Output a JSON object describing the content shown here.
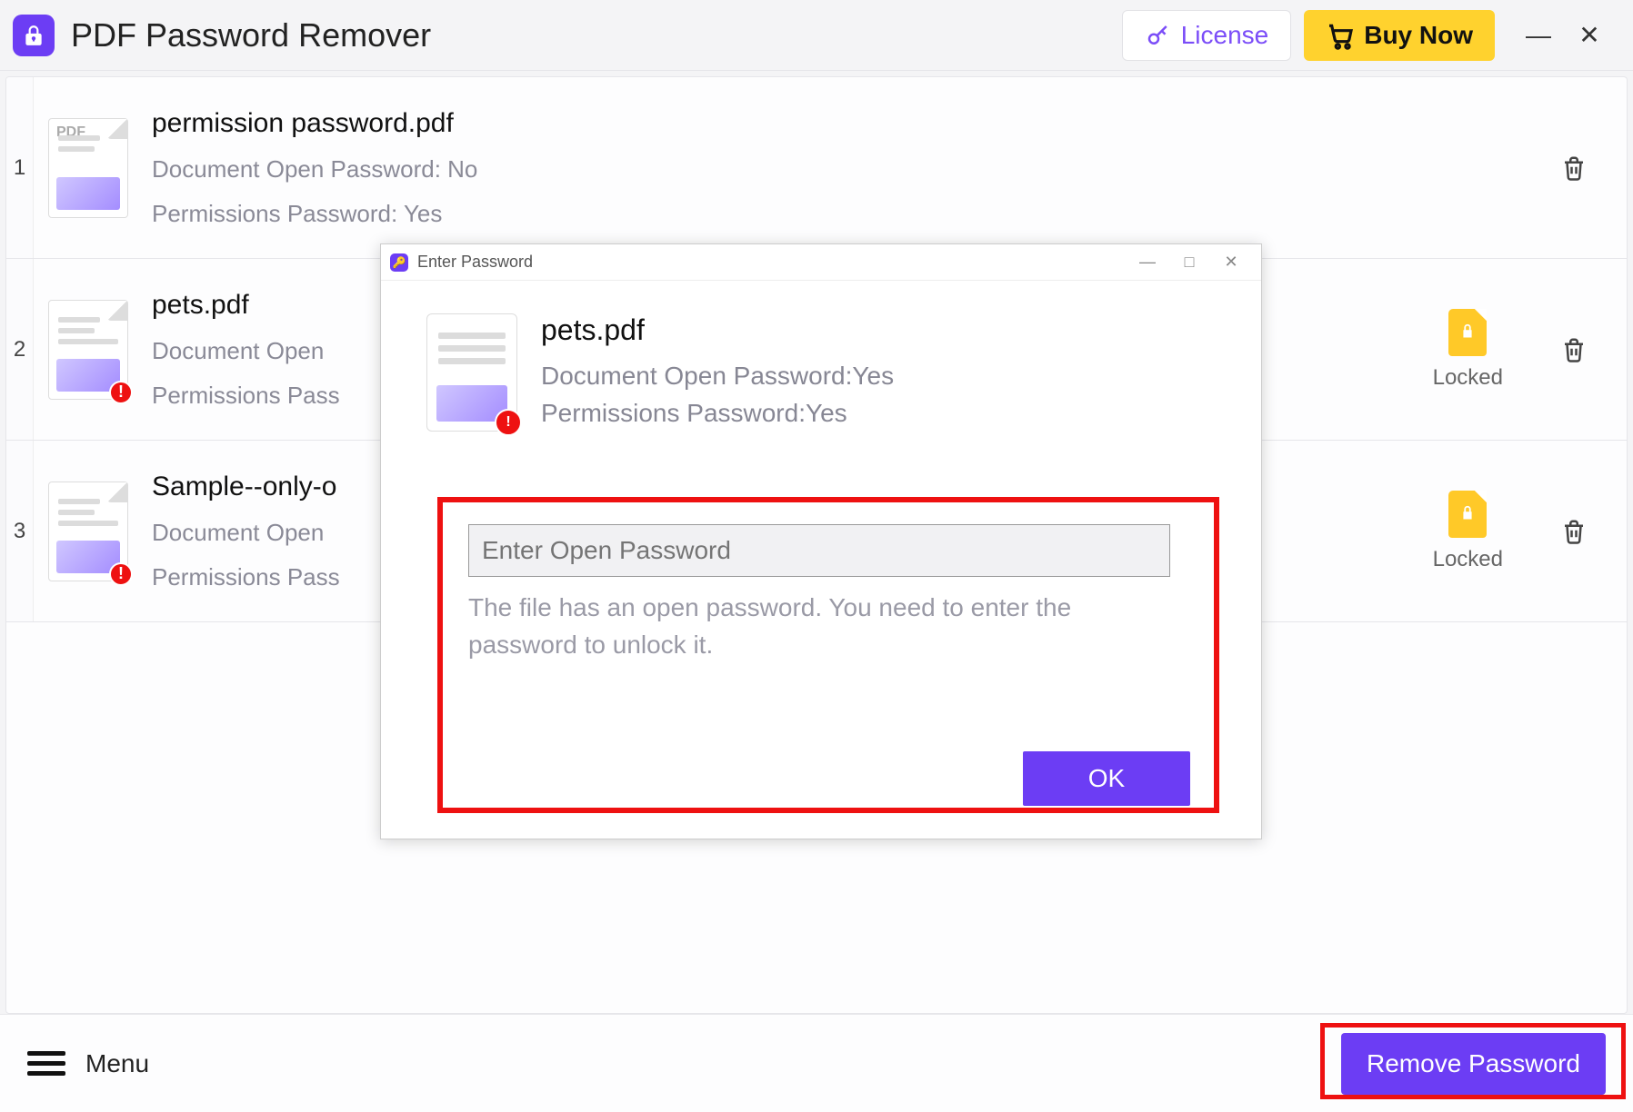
{
  "app": {
    "title": "PDF Password Remover"
  },
  "header": {
    "license_label": "License",
    "buynow_label": "Buy Now"
  },
  "files": [
    {
      "index": "1",
      "name": "permission password.pdf",
      "open_pw_line": "Document Open Password: No",
      "perm_pw_line": "Permissions Password: Yes",
      "locked": false,
      "alert": false,
      "pdf_badge": true
    },
    {
      "index": "2",
      "name": "pets.pdf",
      "open_pw_line": "Document Open",
      "perm_pw_line": "Permissions Pass",
      "locked": true,
      "locked_label": "Locked",
      "alert": true,
      "pdf_badge": false
    },
    {
      "index": "3",
      "name": "Sample--only-o",
      "open_pw_line": "Document Open",
      "perm_pw_line": "Permissions Pass",
      "locked": true,
      "locked_label": "Locked",
      "alert": true,
      "pdf_badge": false
    }
  ],
  "bottom": {
    "menu_label": "Menu",
    "remove_label": "Remove Password"
  },
  "dialog": {
    "title": "Enter Password",
    "file_name": "pets.pdf",
    "open_pw_line": "Document Open Password:Yes",
    "perm_pw_line": "Permissions Password:Yes",
    "input_placeholder": "Enter Open Password",
    "hint": "The file has an open password. You need to enter the password to unlock it.",
    "ok_label": "OK"
  }
}
